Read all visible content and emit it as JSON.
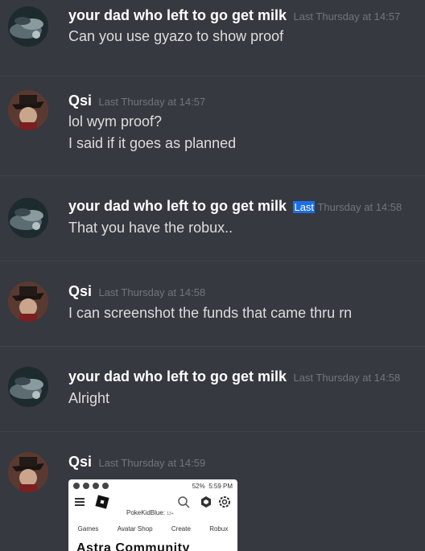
{
  "messages": [
    {
      "author": "your dad who left to go get milk",
      "timestamp": "Last Thursday at 14:57",
      "lines": [
        "Can you use gyazo to show proof"
      ]
    },
    {
      "author": "Qsi",
      "timestamp": "Last Thursday at 14:57",
      "lines": [
        "lol wym proof?",
        "I said if it goes as planned"
      ]
    },
    {
      "author": "your dad who left to go get milk",
      "timestamp_highlight": "Last",
      "timestamp_rest": "Thursday at 14:58",
      "lines": [
        "That you have the robux.."
      ]
    },
    {
      "author": "Qsi",
      "timestamp": "Last Thursday at 14:58",
      "lines": [
        "I can screenshot the funds that came thru rn"
      ]
    },
    {
      "author": "your dad who left to go get milk",
      "timestamp": "Last Thursday at 14:58",
      "lines": [
        "Alright"
      ]
    },
    {
      "author": "Qsi",
      "timestamp": "Last Thursday at 14:59",
      "lines": []
    }
  ],
  "attachment": {
    "status_battery": "52%",
    "status_time": "5:59 PM",
    "username": "PokeKidBlue:",
    "age_tag": "13+",
    "tabs": [
      "Games",
      "Avatar Shop",
      "Create",
      "Robux"
    ],
    "heading": "Astra Community"
  },
  "icons": {
    "avatar_storm": "storm-avatar-icon",
    "avatar_hat": "hat-avatar-icon",
    "menu": "hamburger-menu-icon",
    "roblox": "roblox-logo-icon",
    "search": "search-icon",
    "robux": "robux-icon",
    "settings": "gear-icon"
  },
  "colors": {
    "background": "#36393f",
    "username": "#ffffff",
    "timestamp": "#72767d",
    "message_text": "#dcddde",
    "selection": "#1e6ee8"
  }
}
